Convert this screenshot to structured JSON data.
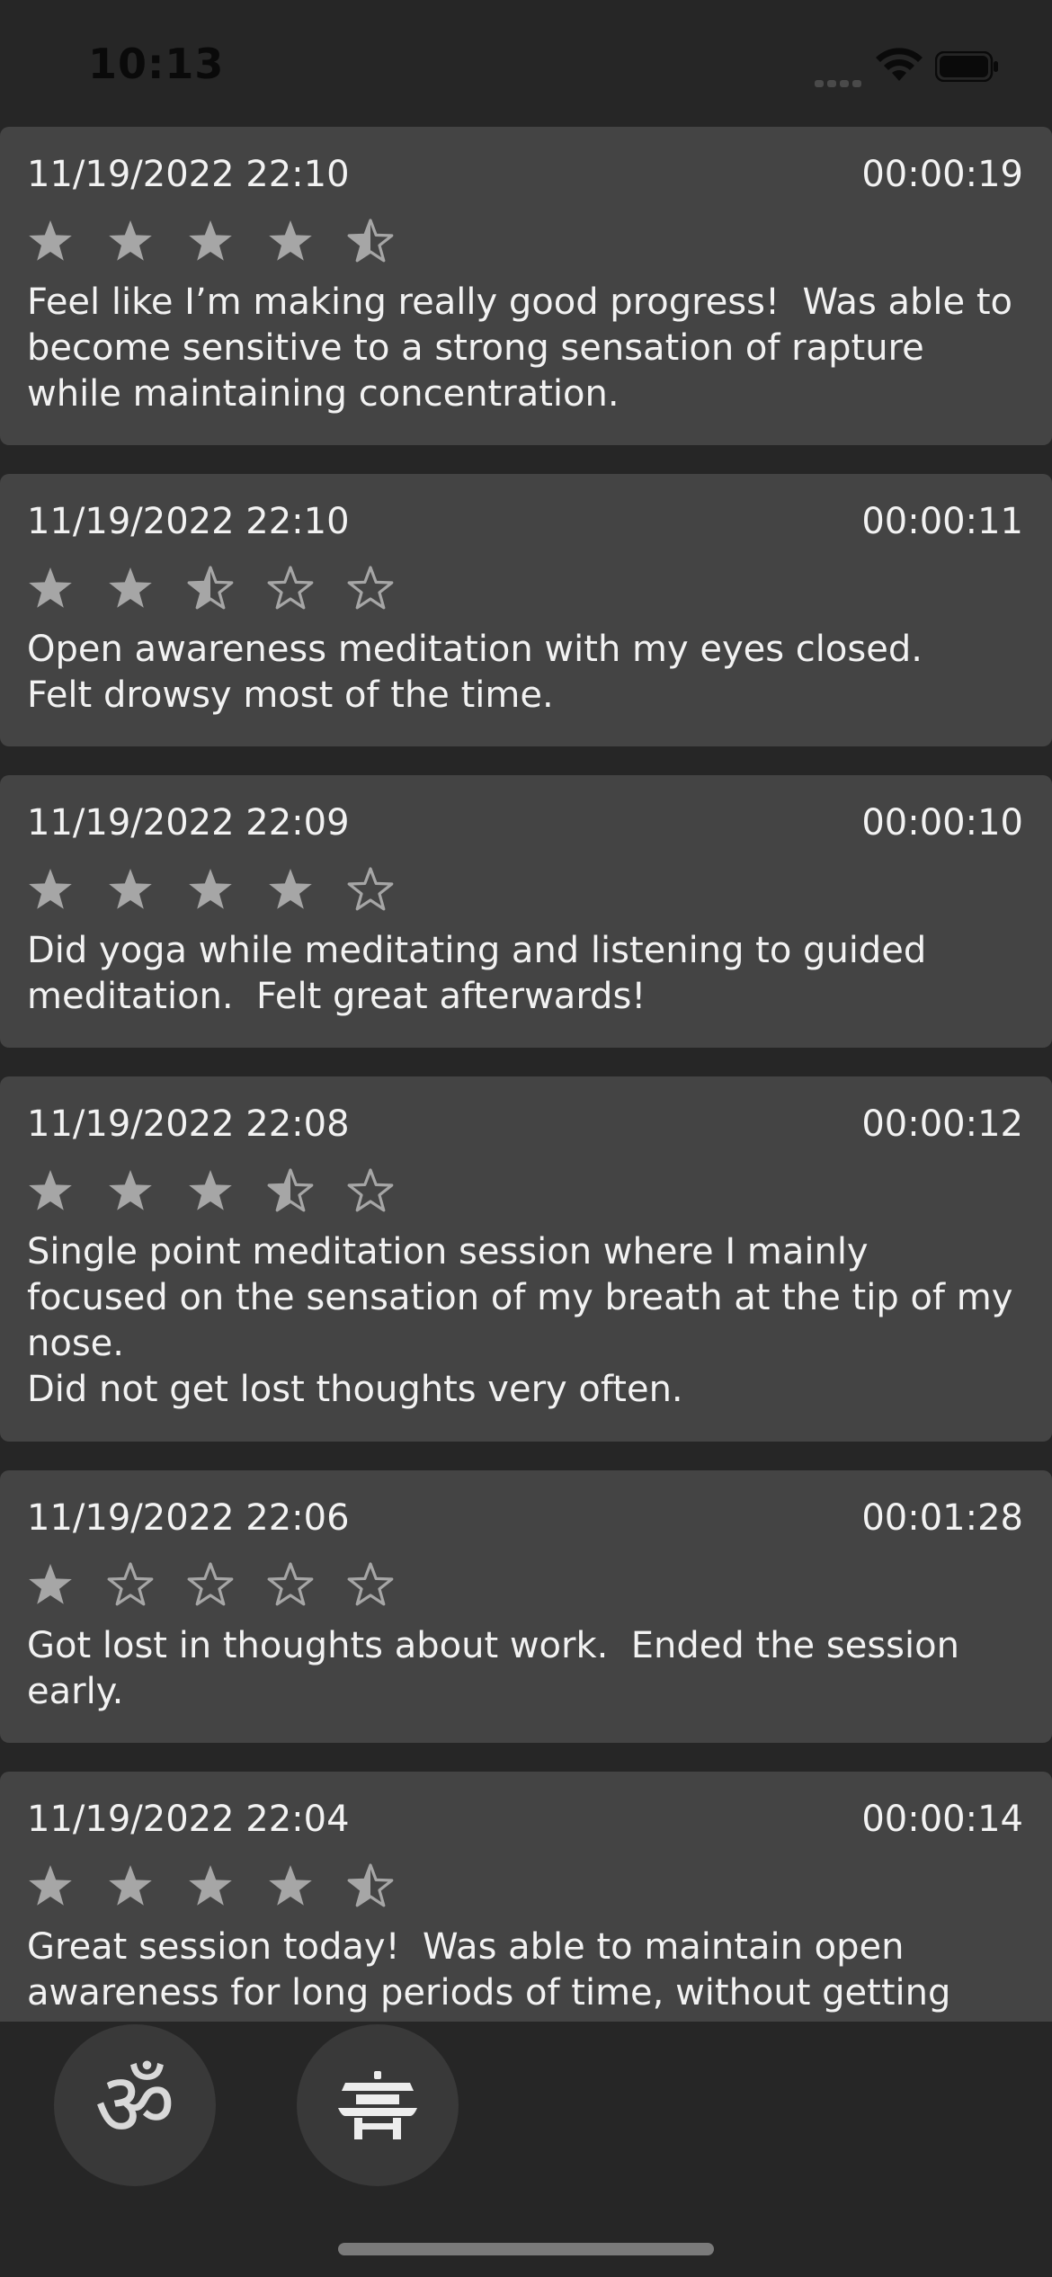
{
  "status_bar": {
    "time": "10:13"
  },
  "entries": [
    {
      "date": "11/19/2022 22:10",
      "duration": "00:00:19",
      "rating": 4.5,
      "note": "Feel like I’m making really good progress!  Was able to become sensitive to a strong sensation of rapture while maintaining concentration."
    },
    {
      "date": "11/19/2022 22:10",
      "duration": "00:00:11",
      "rating": 2.5,
      "note": "Open awareness meditation with my eyes closed.\nFelt drowsy most of the time."
    },
    {
      "date": "11/19/2022 22:09",
      "duration": "00:00:10",
      "rating": 4,
      "note": "Did yoga while meditating and listening to guided meditation.  Felt great afterwards!"
    },
    {
      "date": "11/19/2022 22:08",
      "duration": "00:00:12",
      "rating": 3.5,
      "note": "Single point meditation session where I mainly focused on the sensation of my breath at the tip of my nose.\nDid not get lost thoughts very often."
    },
    {
      "date": "11/19/2022 22:06",
      "duration": "00:01:28",
      "rating": 1,
      "note": "Got lost in thoughts about work.  Ended the session early."
    },
    {
      "date": "11/19/2022 22:04",
      "duration": "00:00:14",
      "rating": 4.5,
      "note": "Great session today!  Was able to maintain open awareness for long periods of time, without getting"
    }
  ],
  "tab_bar": {
    "om_glyph": "ॐ",
    "tabs": [
      {
        "icon": "om-icon"
      },
      {
        "icon": "temple-icon"
      }
    ]
  },
  "colors": {
    "background": "#262626",
    "card": "#444444",
    "star": "#a6a6a6",
    "text": "#f2f2f2"
  }
}
